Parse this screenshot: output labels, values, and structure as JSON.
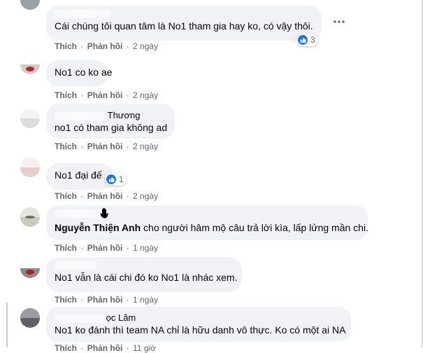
{
  "colors": {
    "bubble_bg": "#f0f2f5",
    "meta_text": "#65676b",
    "like_blue": "#1877f2",
    "page_bg": "#ffffff"
  },
  "icons": {
    "like": "thumbs-up-icon",
    "more": "more-horizontal-icon",
    "badge": "waving-hand-icon"
  },
  "actions": {
    "like_label": "Thích",
    "reply_label": "Phản hồi",
    "separator": "·"
  },
  "comments": [
    {
      "author": "",
      "text": "Cái chúng tôi quan tâm là No1 tham gia hay ko, có vậy thôi.",
      "time": "2 ngày",
      "reactions": "3"
    },
    {
      "author": "",
      "text": "No1 co ko ae",
      "time": "2 ngày"
    },
    {
      "author": "Thương",
      "text": "no1 có tham gia không ad",
      "time": "2 ngày"
    },
    {
      "author": "",
      "text": "No1 đại đế",
      "time": "2 ngày",
      "reactions": "1"
    },
    {
      "author": "",
      "mention": "Nguyễn Thiện Anh",
      "text": "cho người hâm mộ câu trả lời kìa, lấp lửng mần chi.",
      "time": "1 ngày"
    },
    {
      "author": "",
      "text": "No1 vẫn là cái chi đó ko No1 là nhác xem.",
      "time": "1 ngày"
    },
    {
      "author": "ọc Lâm",
      "text": "No1 ko đánh thì team NA chỉ là hữu danh vô thực. Ko có một ai NA",
      "time": "11 giờ"
    }
  ]
}
